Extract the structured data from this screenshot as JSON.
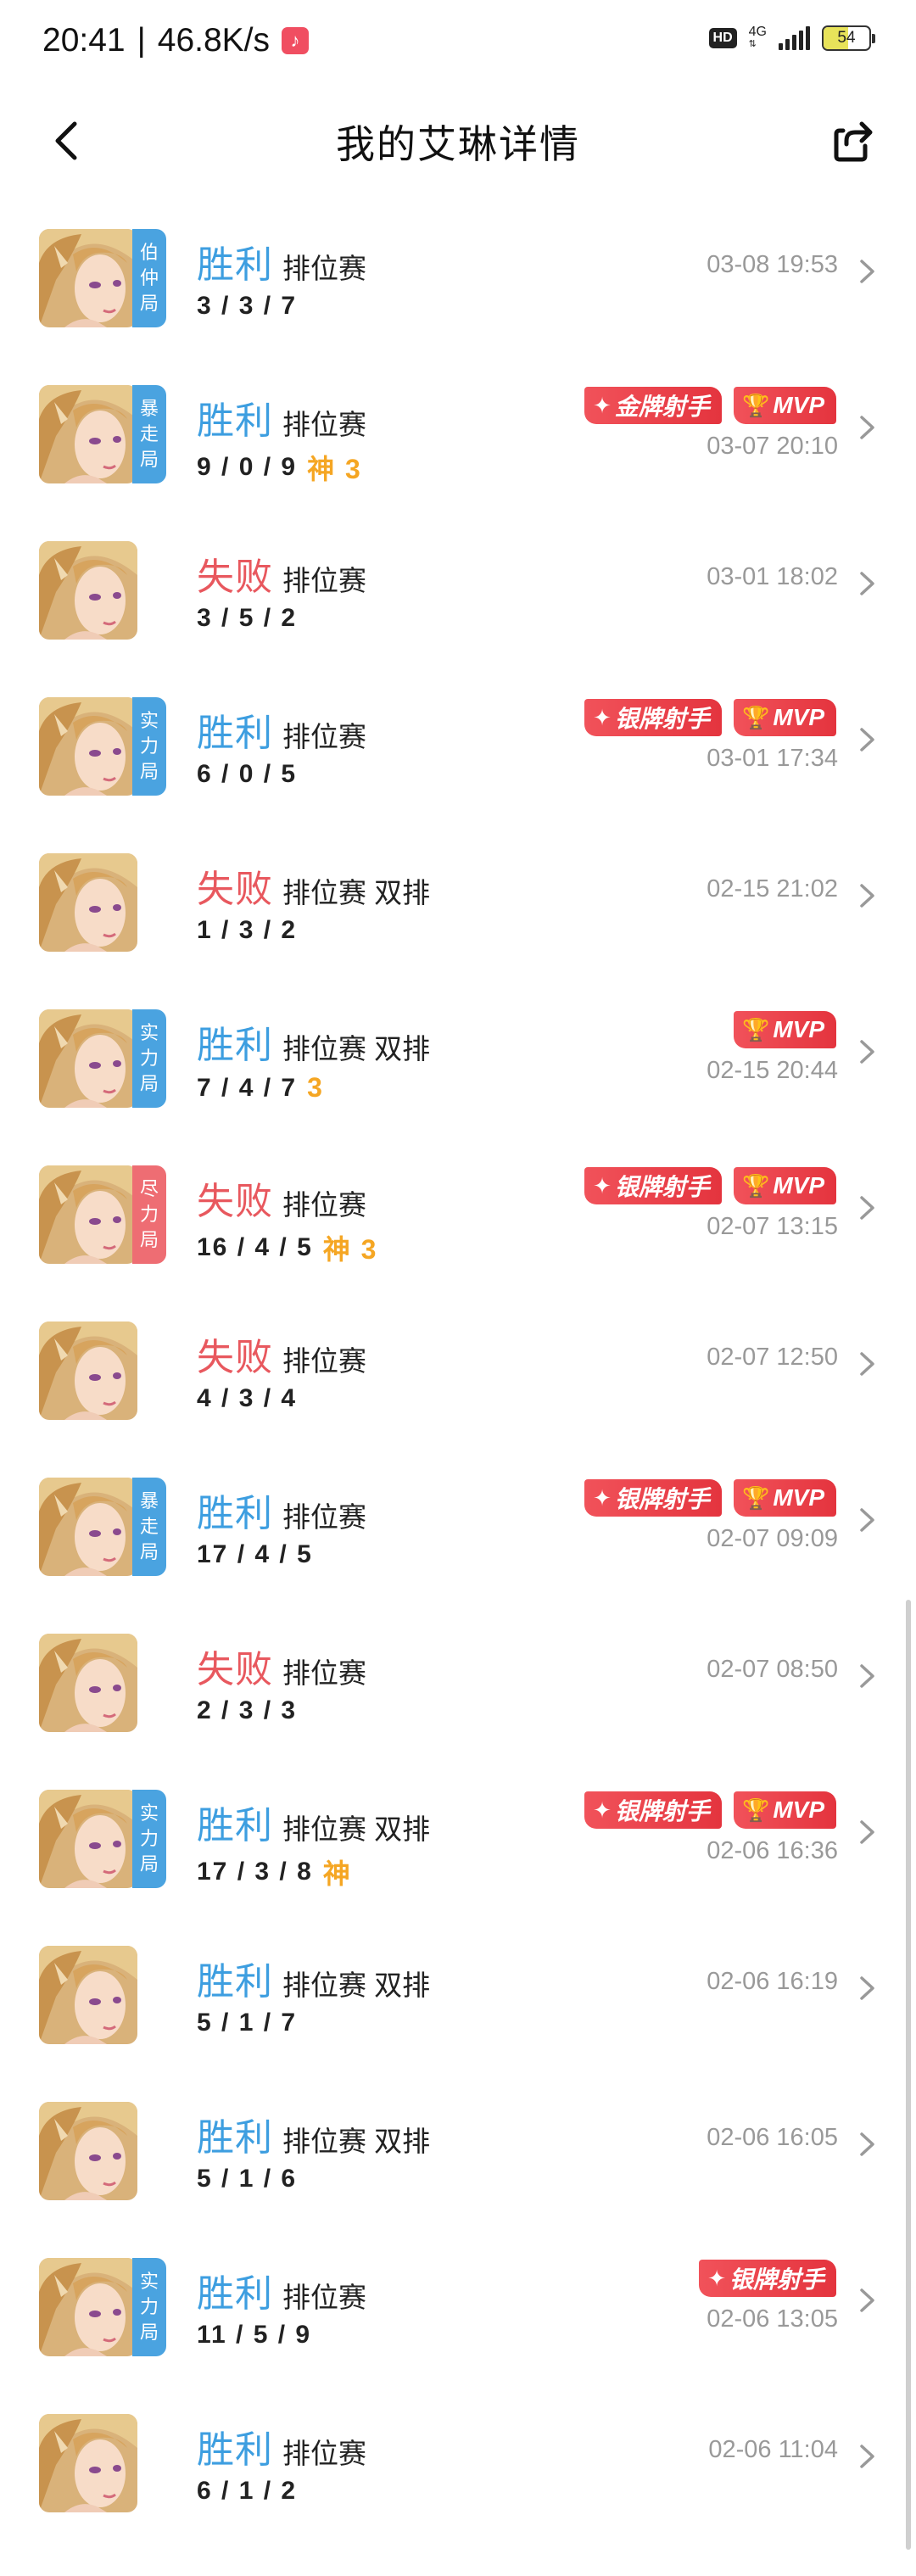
{
  "status_bar": {
    "time": "20:41",
    "speed": "46.8K/s",
    "hd": "HD",
    "network": "4G",
    "battery": "54",
    "battery_level": 0.54,
    "music_icon": "music-note-icon"
  },
  "header": {
    "title": "我的艾琳详情",
    "back_icon": "chevron-left-icon",
    "share_icon": "share-icon"
  },
  "colors": {
    "win": "#3d9ee0",
    "loss": "#e8585e",
    "tier_blue": "#4aa3e0",
    "tier_red": "#ee6d73",
    "badge_red": "#e8434b",
    "god_gold": "#f5a623"
  },
  "matches": [
    {
      "result": "胜利",
      "outcome": "win",
      "mode": "排位赛",
      "kda": "3 / 3 / 7",
      "god": "",
      "time": "03-08 19:53",
      "tier": [
        "伯",
        "仲",
        "局"
      ],
      "tier_color": "blue",
      "badges": []
    },
    {
      "result": "胜利",
      "outcome": "win",
      "mode": "排位赛",
      "kda": "9 / 0 / 9",
      "god": "神 3",
      "time": "03-07 20:10",
      "tier": [
        "暴",
        "走",
        "局"
      ],
      "tier_color": "blue",
      "badges": [
        {
          "label": "金牌射手",
          "icon": "diamond-star-icon"
        },
        {
          "label": "MVP",
          "icon": "trophy-icon"
        }
      ]
    },
    {
      "result": "失败",
      "outcome": "loss",
      "mode": "排位赛",
      "kda": "3 / 5 / 2",
      "god": "",
      "time": "03-01 18:02",
      "tier": [],
      "tier_color": "",
      "badges": []
    },
    {
      "result": "胜利",
      "outcome": "win",
      "mode": "排位赛",
      "kda": "6 / 0 / 5",
      "god": "",
      "time": "03-01 17:34",
      "tier": [
        "实",
        "力",
        "局"
      ],
      "tier_color": "blue",
      "badges": [
        {
          "label": "银牌射手",
          "icon": "diamond-star-icon"
        },
        {
          "label": "MVP",
          "icon": "trophy-icon"
        }
      ]
    },
    {
      "result": "失败",
      "outcome": "loss",
      "mode": "排位赛 双排",
      "kda": "1 / 3 / 2",
      "god": "",
      "time": "02-15 21:02",
      "tier": [],
      "tier_color": "",
      "badges": []
    },
    {
      "result": "胜利",
      "outcome": "win",
      "mode": "排位赛 双排",
      "kda": "7 / 4 / 7",
      "god": "3",
      "time": "02-15 20:44",
      "tier": [
        "实",
        "力",
        "局"
      ],
      "tier_color": "blue",
      "badges": [
        {
          "label": "MVP",
          "icon": "trophy-icon"
        }
      ]
    },
    {
      "result": "失败",
      "outcome": "loss",
      "mode": "排位赛",
      "kda": "16 / 4 / 5",
      "god": "神 3",
      "time": "02-07 13:15",
      "tier": [
        "尽",
        "力",
        "局"
      ],
      "tier_color": "red",
      "badges": [
        {
          "label": "银牌射手",
          "icon": "diamond-star-icon"
        },
        {
          "label": "MVP",
          "icon": "trophy-icon"
        }
      ]
    },
    {
      "result": "失败",
      "outcome": "loss",
      "mode": "排位赛",
      "kda": "4 / 3 / 4",
      "god": "",
      "time": "02-07 12:50",
      "tier": [],
      "tier_color": "",
      "badges": []
    },
    {
      "result": "胜利",
      "outcome": "win",
      "mode": "排位赛",
      "kda": "17 / 4 / 5",
      "god": "",
      "time": "02-07 09:09",
      "tier": [
        "暴",
        "走",
        "局"
      ],
      "tier_color": "blue",
      "badges": [
        {
          "label": "银牌射手",
          "icon": "diamond-star-icon"
        },
        {
          "label": "MVP",
          "icon": "trophy-icon"
        }
      ]
    },
    {
      "result": "失败",
      "outcome": "loss",
      "mode": "排位赛",
      "kda": "2 / 3 / 3",
      "god": "",
      "time": "02-07 08:50",
      "tier": [],
      "tier_color": "",
      "badges": []
    },
    {
      "result": "胜利",
      "outcome": "win",
      "mode": "排位赛 双排",
      "kda": "17 / 3 / 8",
      "god": "神",
      "time": "02-06 16:36",
      "tier": [
        "实",
        "力",
        "局"
      ],
      "tier_color": "blue",
      "badges": [
        {
          "label": "银牌射手",
          "icon": "diamond-star-icon"
        },
        {
          "label": "MVP",
          "icon": "trophy-icon"
        }
      ]
    },
    {
      "result": "胜利",
      "outcome": "win",
      "mode": "排位赛 双排",
      "kda": "5 / 1 / 7",
      "god": "",
      "time": "02-06 16:19",
      "tier": [],
      "tier_color": "",
      "badges": []
    },
    {
      "result": "胜利",
      "outcome": "win",
      "mode": "排位赛 双排",
      "kda": "5 / 1 / 6",
      "god": "",
      "time": "02-06 16:05",
      "tier": [],
      "tier_color": "",
      "badges": []
    },
    {
      "result": "胜利",
      "outcome": "win",
      "mode": "排位赛",
      "kda": "11 / 5 / 9",
      "god": "",
      "time": "02-06 13:05",
      "tier": [
        "实",
        "力",
        "局"
      ],
      "tier_color": "blue",
      "badges": [
        {
          "label": "银牌射手",
          "icon": "diamond-star-icon"
        }
      ]
    },
    {
      "result": "胜利",
      "outcome": "win",
      "mode": "排位赛",
      "kda": "6 / 1 / 2",
      "god": "",
      "time": "02-06 11:04",
      "tier": [],
      "tier_color": "",
      "badges": []
    }
  ]
}
